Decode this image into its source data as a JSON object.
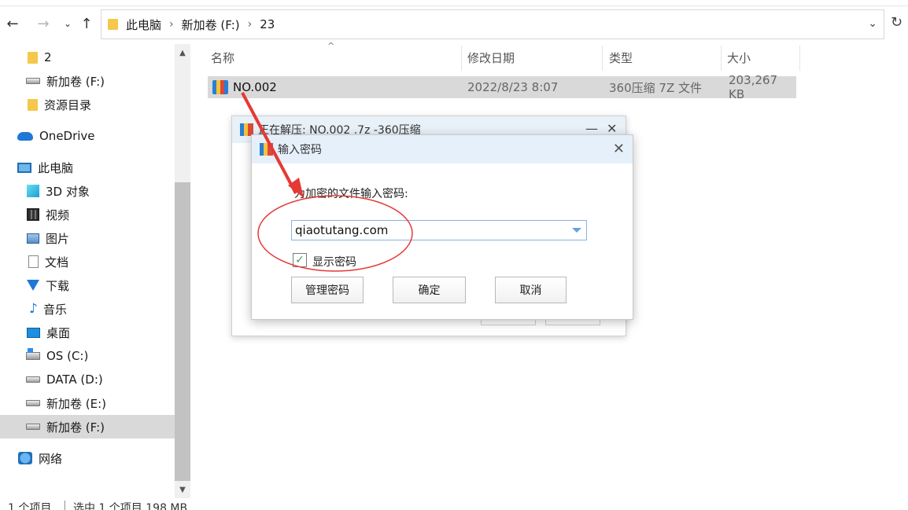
{
  "address": {
    "crumbs": [
      "此电脑",
      "新加卷 (F:)",
      "23"
    ]
  },
  "sidebar": {
    "items": [
      {
        "label": "2",
        "icon": "folder-icon"
      },
      {
        "label": "新加卷 (F:)",
        "icon": "drive-icon"
      },
      {
        "label": "资源目录",
        "icon": "folder-icon"
      },
      {
        "label": "OneDrive",
        "icon": "onedrive-icon"
      },
      {
        "label": "此电脑",
        "icon": "this-pc-icon"
      },
      {
        "label": "3D 对象",
        "icon": "3d-objects-icon"
      },
      {
        "label": "视频",
        "icon": "videos-icon"
      },
      {
        "label": "图片",
        "icon": "pictures-icon"
      },
      {
        "label": "文档",
        "icon": "documents-icon"
      },
      {
        "label": "下载",
        "icon": "downloads-icon"
      },
      {
        "label": "音乐",
        "icon": "music-icon"
      },
      {
        "label": "桌面",
        "icon": "desktop-icon"
      },
      {
        "label": "OS (C:)",
        "icon": "os-drive-icon"
      },
      {
        "label": "DATA (D:)",
        "icon": "drive-icon"
      },
      {
        "label": "新加卷 (E:)",
        "icon": "drive-icon"
      },
      {
        "label": "新加卷 (F:)",
        "icon": "drive-icon"
      },
      {
        "label": "网络",
        "icon": "network-icon"
      }
    ]
  },
  "columns": {
    "name": "名称",
    "modified": "修改日期",
    "type": "类型",
    "size": "大小"
  },
  "files": [
    {
      "name": "NO.002",
      "modified": "2022/8/23 8:07",
      "type": "360压缩 7Z 文件",
      "size": "203,267 KB"
    }
  ],
  "back_dialog": {
    "title": "正在解压: NO.002 .7z -360压缩"
  },
  "password_dialog": {
    "title": "输入密码",
    "prompt": "为加密的文件输入密码:",
    "password_value": "qiaotutang.com",
    "show_password_label": "显示密码",
    "show_password_checked": true,
    "buttons": {
      "manage": "管理密码",
      "ok": "确定",
      "cancel": "取消"
    }
  },
  "status": {
    "count": "1 个项目",
    "selected": "选中 1 个项目 198 MB"
  },
  "colors": {
    "selection": "#d9d9d9",
    "annotation": "#e53935",
    "dialog_title_bg": "#e6f0fa"
  }
}
